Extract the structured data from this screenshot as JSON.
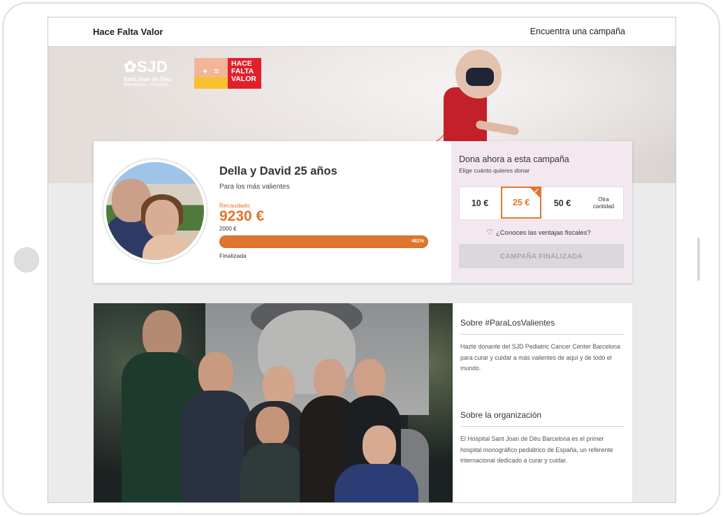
{
  "header": {
    "brand": "Hace Falta Valor",
    "find_link": "Encuentra una campaña"
  },
  "hero": {
    "logo_sjd": {
      "mark": "SJD",
      "line1": "Sant Joan de Déu",
      "line2": "Barcelona · Hospital"
    },
    "logo_hfv": {
      "text": "HACE FALTA VALOR"
    }
  },
  "campaign": {
    "title": "Della y David 25 años",
    "subtitle": "Para los más valientes",
    "raised_label": "Recaudado",
    "raised_amount": "9230 €",
    "goal": "2000 €",
    "progress_label": "461%",
    "progress_percent": 461,
    "status": "Finalizada"
  },
  "donate": {
    "title": "Dona ahora a esta campaña",
    "subtitle": "Elige cuánto quieres donar",
    "amounts": [
      "10 €",
      "25 €",
      "50 €"
    ],
    "other_line1": "Otra",
    "other_line2": "cantidad",
    "selected_index": 1,
    "fiscal_link": "¿Conoces las ventajas fiscales?",
    "finished_button": "CAMPAÑA FINALIZADA"
  },
  "about": {
    "section1_title": "Sobre #ParaLosValientes",
    "section1_text": "Hazte donante del SJD Pediatric Cancer Center Barcelona para curar y cuidar a más valientes de aquí y de todo el mundo.",
    "section2_title": "Sobre la organización",
    "section2_text": "El Hospital Sant Joan de Déu Barcelona es el primer hospital monográfico pediátrico de España, un referente internacional dedicado a curar y cuidar."
  },
  "colors": {
    "accent": "#e0752d",
    "donate_bg": "#f3e8f0",
    "hfv_red": "#e2202c"
  }
}
